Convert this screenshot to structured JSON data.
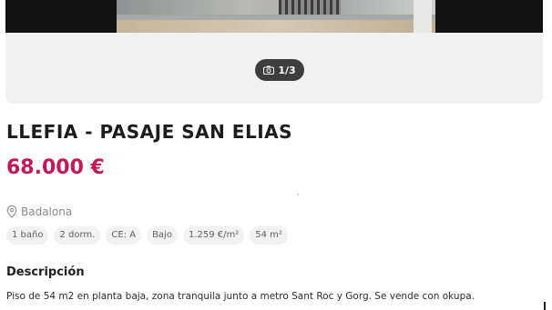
{
  "gallery": {
    "counter": "1/3",
    "camera_icon": "camera-icon"
  },
  "listing": {
    "title": "LLEFIA - PASAJE SAN ELIAS",
    "price": "68.000 €",
    "location": "Badalona",
    "location_icon": "map-pin-icon",
    "features": [
      "1 baño",
      "2 dorm.",
      "CE: A",
      "Bajo",
      "1.259 €/m²",
      "54 m²"
    ]
  },
  "description": {
    "heading": "Descripción",
    "text": "Piso de 54 m2 en planta baja, zona tranquila junto a metro Sant Roc y Gorg. Se vende con okupa."
  },
  "colors": {
    "price": "#c2185b",
    "badge_bg": "#3d3d3d",
    "chip_bg": "#f2f2f2"
  }
}
